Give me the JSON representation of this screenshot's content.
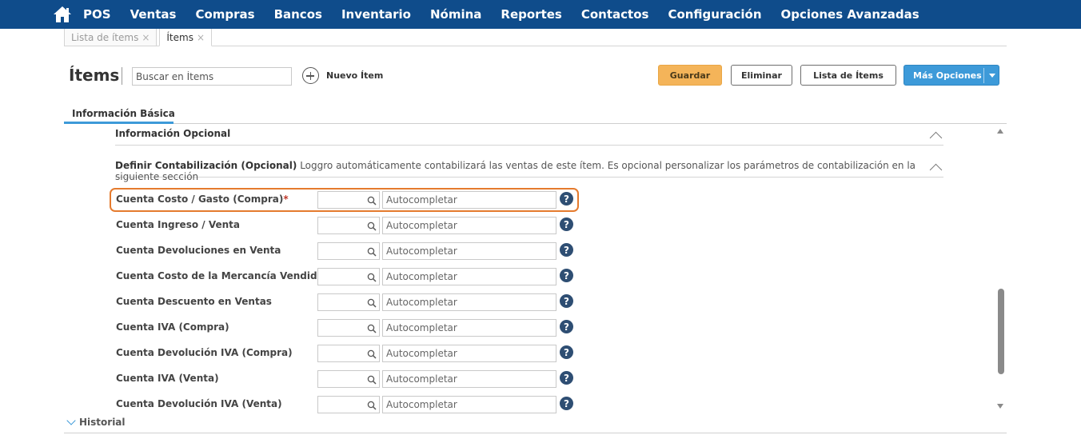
{
  "nav": {
    "items": [
      "POS",
      "Ventas",
      "Compras",
      "Bancos",
      "Inventario",
      "Nómina",
      "Reportes",
      "Contactos",
      "Configuración",
      "Opciones Avanzadas"
    ],
    "bg_color": "#0f4c8b"
  },
  "tabs": [
    {
      "label": "Lista de ítems",
      "close": "×",
      "active": false
    },
    {
      "label": "Ítems",
      "close": "×",
      "active": true
    }
  ],
  "header": {
    "title": "Ítems",
    "search_placeholder": "Buscar en Ítems",
    "new_item_label": "Nuevo Ítem"
  },
  "buttons": {
    "save": "Guardar",
    "delete": "Eliminar",
    "list": "Lista de Ítems",
    "more": "Más Opciones"
  },
  "section_tab": {
    "label": "Información Básica"
  },
  "optional_section": {
    "title": "Información Opcional"
  },
  "accounting_section": {
    "title": "Definir Contabilización (Opcional)",
    "description": "Loggro automáticamente contabilizará las ventas de este ítem. Es opcional personalizar los parámetros de contabilización en la siguiente sección"
  },
  "accounts": [
    {
      "label": "Cuenta Costo / Gasto (Compra)",
      "required": "*",
      "placeholder": "Autocompletar"
    },
    {
      "label": "Cuenta Ingreso / Venta",
      "required": "",
      "placeholder": "Autocompletar"
    },
    {
      "label": "Cuenta Devoluciones en Venta",
      "required": "",
      "placeholder": "Autocompletar"
    },
    {
      "label": "Cuenta Costo de la Mercancía Vendida",
      "required": "",
      "placeholder": "Autocompletar"
    },
    {
      "label": "Cuenta Descuento en Ventas",
      "required": "",
      "placeholder": "Autocompletar"
    },
    {
      "label": "Cuenta IVA (Compra)",
      "required": "",
      "placeholder": "Autocompletar"
    },
    {
      "label": "Cuenta Devolución IVA (Compra)",
      "required": "",
      "placeholder": "Autocompletar"
    },
    {
      "label": "Cuenta IVA (Venta)",
      "required": "",
      "placeholder": "Autocompletar"
    },
    {
      "label": "Cuenta Devolución IVA (Venta)",
      "required": "",
      "placeholder": "Autocompletar"
    }
  ],
  "help_glyph": "?",
  "historial": {
    "label": "Historial"
  },
  "colors": {
    "accent": "#3d9ad9",
    "save": "#f4b459",
    "highlight": "#e57b2e",
    "help": "#2e4e73"
  }
}
